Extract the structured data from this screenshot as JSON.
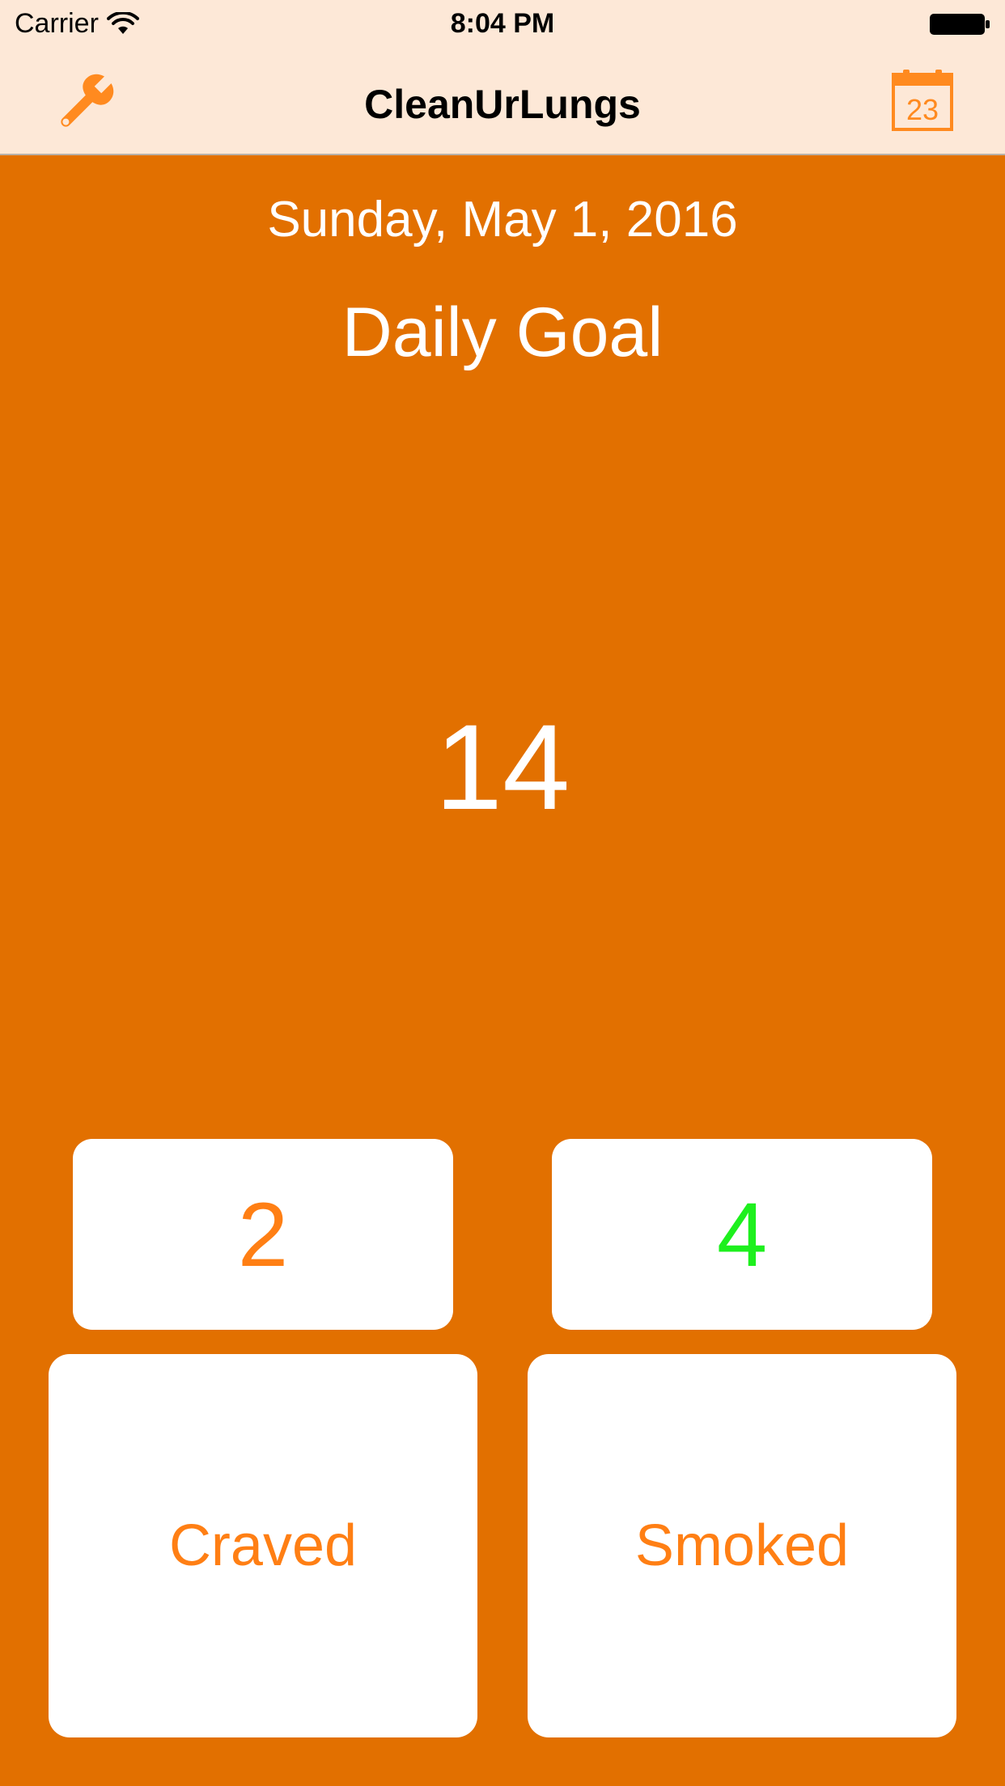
{
  "status_bar": {
    "carrier": "Carrier",
    "time": "8:04 PM"
  },
  "nav": {
    "title": "CleanUrLungs",
    "left_icon": "wrench-icon",
    "right_icon": "calendar-icon",
    "calendar_day": "23",
    "accent_color": "#FF8A1F"
  },
  "main": {
    "date": "Sunday, May 1, 2016",
    "goal_label": "Daily Goal",
    "goal_value": "14",
    "background_color": "#E27000"
  },
  "counters": {
    "craved_count": "2",
    "smoked_count": "4",
    "craved_color": "#FF7F14",
    "smoked_color": "#1EF01E"
  },
  "buttons": {
    "craved_label": "Craved",
    "smoked_label": "Smoked"
  }
}
